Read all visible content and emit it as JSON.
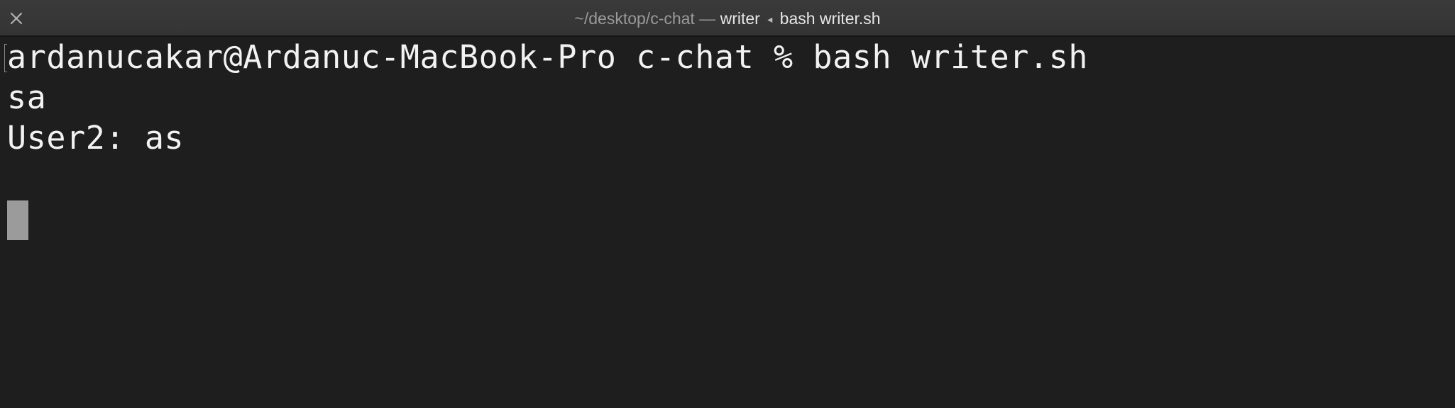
{
  "window": {
    "title_path": "~/desktop/c-chat",
    "title_separator": "—",
    "title_process": "writer",
    "title_arrow": "◂",
    "title_command": "bash writer.sh",
    "close_icon": "close-icon"
  },
  "terminal": {
    "lines": [
      "ardanucakar@Ardanuc-MacBook-Pro c-chat % bash writer.sh",
      "sa",
      "User2: as",
      ""
    ]
  },
  "colors": {
    "background": "#1e1e1e",
    "titlebar": "#383838",
    "text": "#f2f2f2",
    "cursor": "#9b9b9b"
  }
}
